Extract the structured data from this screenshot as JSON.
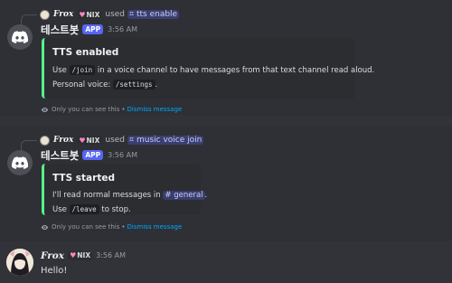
{
  "messages": [
    {
      "reply": {
        "user": "Frox",
        "tag": "NIX",
        "used": "used",
        "command": "tts enable"
      },
      "author": "테스트봇",
      "badge": "APP",
      "time": "3:56 AM",
      "embed": {
        "title": "TTS enabled",
        "line1_pre": "Use",
        "line1_code": "/join",
        "line1_post": "in a voice channel to have messages from that text channel read aloud.",
        "line2_pre": "Personal voice:",
        "line2_code": "/settings",
        "line2_post": "."
      },
      "ephemeral": "Only you can see this",
      "separator": "•",
      "dismiss": "Dismiss message"
    },
    {
      "reply": {
        "user": "Frox",
        "tag": "NIX",
        "used": "used",
        "command": "music voice join"
      },
      "author": "테스트봇",
      "badge": "APP",
      "time": "3:56 AM",
      "embed": {
        "title": "TTS started",
        "line1_pre": "I'll read normal messages in",
        "line1_channel": "# general",
        "line1_post": ".",
        "line2_pre": "Use",
        "line2_code": "/leave",
        "line2_post": "to stop."
      },
      "ephemeral": "Only you can see this",
      "separator": "•",
      "dismiss": "Dismiss message"
    }
  ],
  "user_message": {
    "author": "Frox",
    "tag": "NIX",
    "time": "3:56 AM",
    "text": "Hello!"
  },
  "colors": {
    "background": "#313338",
    "highlight_row": "#2e3035",
    "embed_bg": "#2b2d31",
    "embed_accent": "#57f287",
    "app_badge": "#5865f2",
    "link": "#00a8fc"
  },
  "icons": {
    "bot_avatar": "discord-logo-icon",
    "eye": "eye-icon",
    "heart": "heart-icon",
    "slash_command": "slash-hash-icon"
  }
}
